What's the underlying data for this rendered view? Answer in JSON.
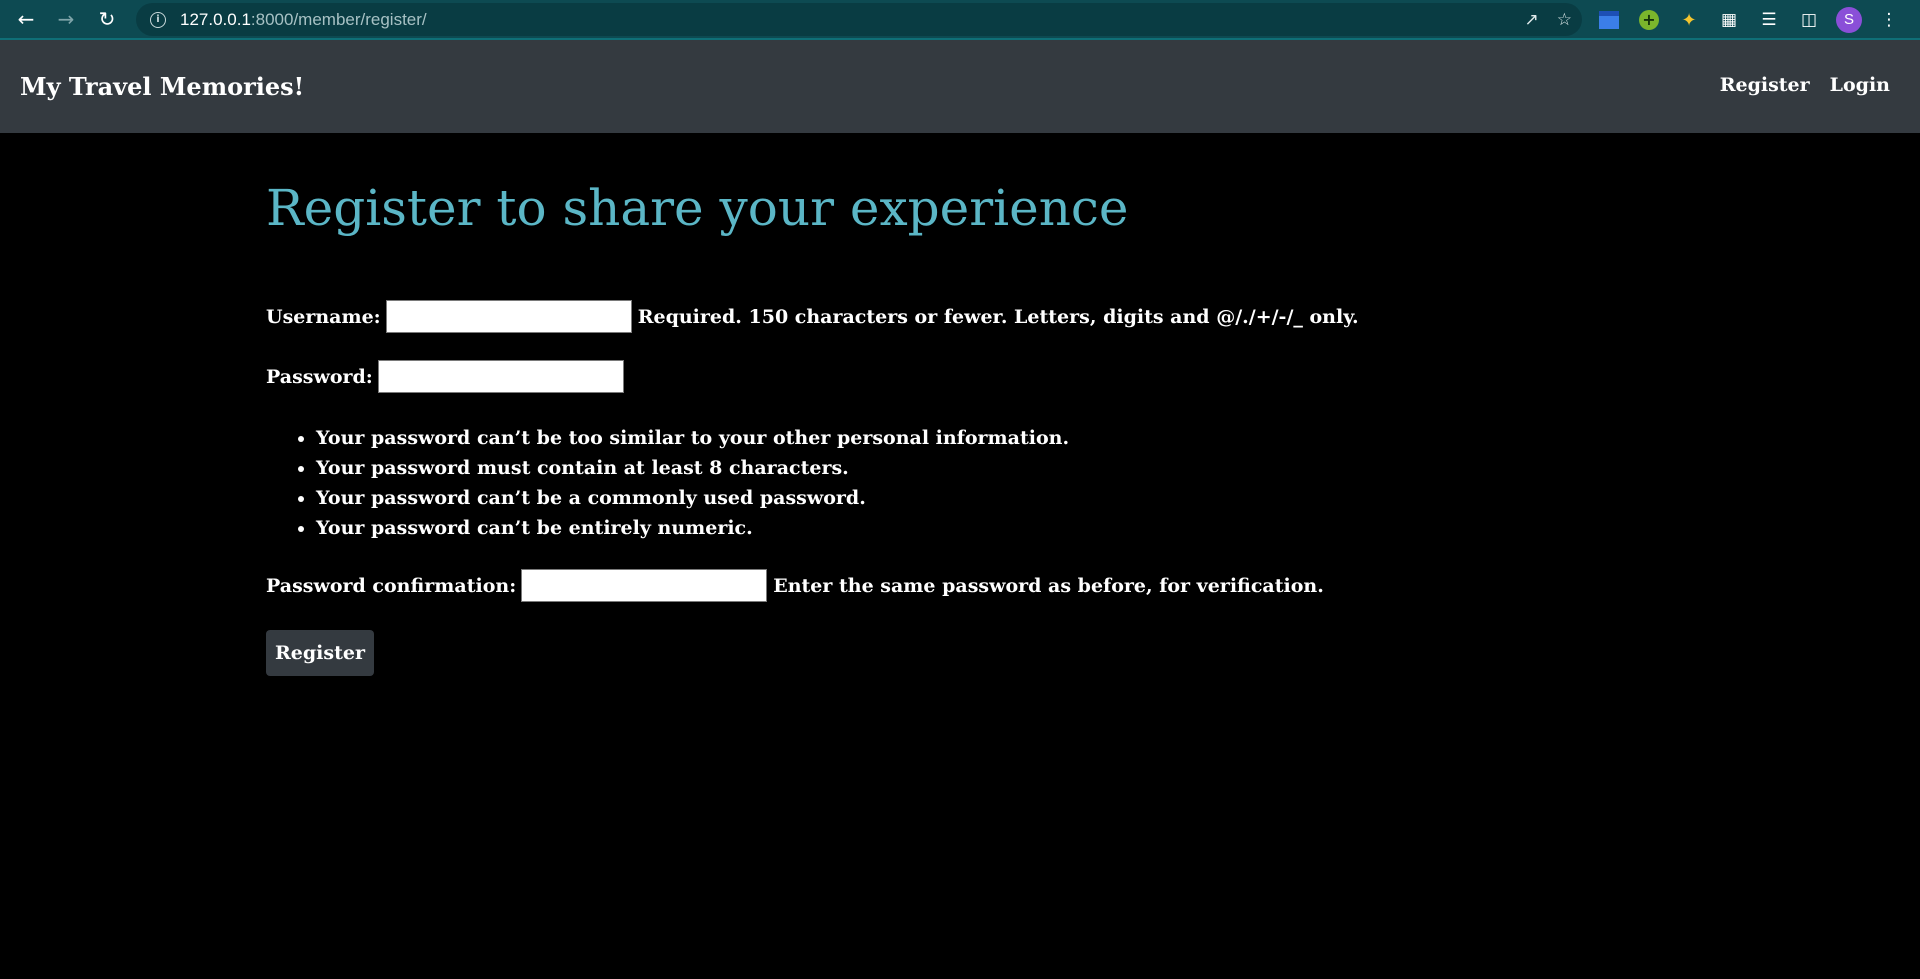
{
  "browser": {
    "url_host": "127.0.0.1",
    "url_rest": ":8000/member/register/",
    "avatar_letter": "S"
  },
  "navbar": {
    "brand": "My Travel Memories!",
    "links": [
      {
        "label": "Register"
      },
      {
        "label": "Login"
      }
    ]
  },
  "page": {
    "title": "Register to share your experience"
  },
  "form": {
    "username_label": "Username:",
    "username_help": "Required. 150 characters or fewer. Letters, digits and @/./+/-/_ only.",
    "password_label": "Password:",
    "password_rules": [
      "Your password can’t be too similar to your other personal information.",
      "Your password must contain at least 8 characters.",
      "Your password can’t be a commonly used password.",
      "Your password can’t be entirely numeric."
    ],
    "confirm_label": "Password confirmation:",
    "confirm_help": "Enter the same password as before, for verification.",
    "submit_label": "Register"
  },
  "colors": {
    "browser_bar": "#0d4a52",
    "navbar": "#343a40",
    "title": "#5bb6c6",
    "background": "#000000"
  }
}
